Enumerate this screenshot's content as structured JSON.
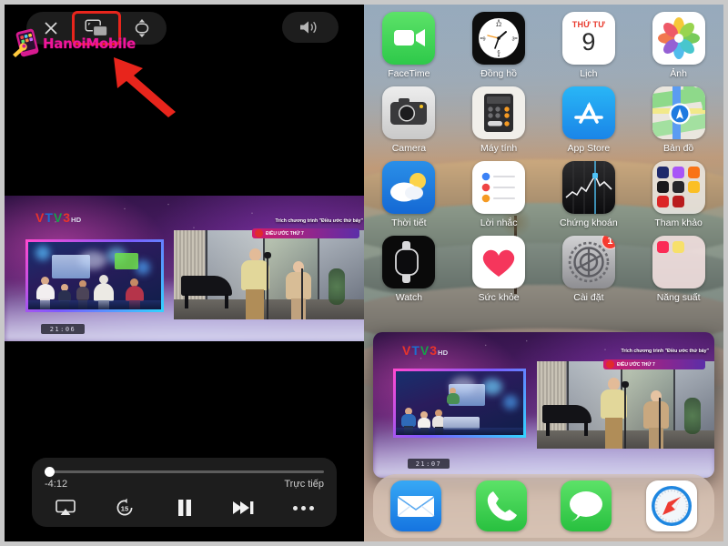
{
  "player": {
    "toolbar": {
      "close_label": "Close",
      "pip_label": "Picture in Picture",
      "fullscreen_label": "Expand",
      "volume_label": "Volume"
    },
    "watermark": {
      "text": "HanoiMobile"
    },
    "annotation": {
      "arrow_color": "#e8251c",
      "highlight_color": "#e8251c"
    },
    "controls": {
      "time_remaining": "-4:12",
      "live_label": "Trực tiếp",
      "airplay_label": "AirPlay",
      "rewind_label": "15",
      "pause_label": "Pause",
      "skip_label": "Skip Forward",
      "more_label": "More"
    },
    "broadcast": {
      "channel": {
        "v1": "V",
        "t": "T",
        "v2": "V",
        "three": "3",
        "hd": "HD"
      },
      "overlay_text": "Trích chương trình \"Điều ước thứ bảy\"",
      "ticker_text": "ĐIỀU ƯỚC THỨ 7",
      "clock_main": "21:06",
      "clock_pip": "21:07"
    }
  },
  "home": {
    "apps": [
      {
        "label": "FaceTime",
        "icon": "facetime-icon"
      },
      {
        "label": "Đồng hồ",
        "icon": "clock-icon"
      },
      {
        "label": "Lịch",
        "icon": "calendar-icon",
        "cal_weekday": "THỨ TƯ",
        "cal_day": "9"
      },
      {
        "label": "Ảnh",
        "icon": "photos-icon"
      },
      {
        "label": "Camera",
        "icon": "camera-icon"
      },
      {
        "label": "Máy tính",
        "icon": "calculator-icon"
      },
      {
        "label": "App Store",
        "icon": "appstore-icon"
      },
      {
        "label": "Bản đồ",
        "icon": "maps-icon"
      },
      {
        "label": "Thời tiết",
        "icon": "weather-icon"
      },
      {
        "label": "Lời nhắc",
        "icon": "reminders-icon"
      },
      {
        "label": "Chứng khoán",
        "icon": "stocks-icon"
      },
      {
        "label": "Tham khảo",
        "icon": "folder-icon"
      },
      {
        "label": "Watch",
        "icon": "watch-icon"
      },
      {
        "label": "Sức khỏe",
        "icon": "health-icon"
      },
      {
        "label": "Cài đặt",
        "icon": "settings-icon",
        "badge": "1"
      },
      {
        "label": "Năng suất",
        "icon": "folder-icon"
      }
    ],
    "dock": [
      {
        "label": "Mail",
        "icon": "mail-icon"
      },
      {
        "label": "Phone",
        "icon": "phone-icon"
      },
      {
        "label": "Messages",
        "icon": "messages-icon"
      },
      {
        "label": "Safari",
        "icon": "safari-icon"
      }
    ]
  }
}
